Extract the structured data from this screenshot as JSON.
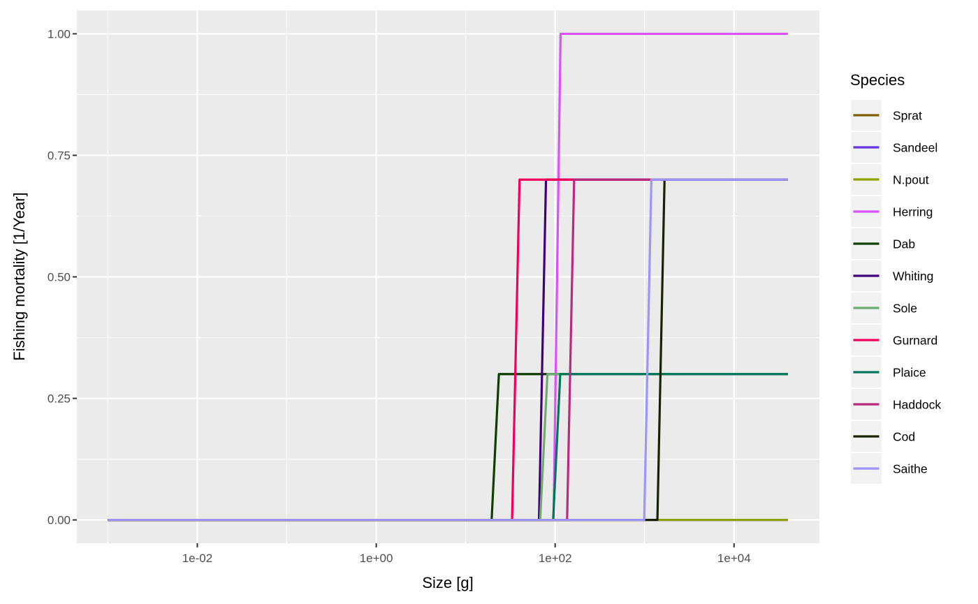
{
  "chart_data": {
    "type": "line",
    "title": "",
    "xlabel": "Size [g]",
    "ylabel": "Fishing mortality [1/Year]",
    "x_scale": "log10",
    "xlim": [
      0.00045,
      90000
    ],
    "ylim": [
      -0.048,
      1.048
    ],
    "x_ticks": [
      {
        "value": 0.01,
        "label": "1e-02"
      },
      {
        "value": 1,
        "label": "1e+00"
      },
      {
        "value": 100,
        "label": "1e+02"
      },
      {
        "value": 10000,
        "label": "1e+04"
      }
    ],
    "y_ticks": [
      {
        "value": 0,
        "label": "0.00"
      },
      {
        "value": 0.25,
        "label": "0.25"
      },
      {
        "value": 0.5,
        "label": "0.50"
      },
      {
        "value": 0.75,
        "label": "0.75"
      },
      {
        "value": 1,
        "label": "1.00"
      }
    ],
    "grid": true,
    "legend": {
      "title": "Species",
      "position": "right"
    },
    "series": [
      {
        "name": "Sprat",
        "color": "#815f00",
        "points": [
          [
            0.001,
            0
          ],
          [
            40000,
            0
          ]
        ]
      },
      {
        "name": "Sandeel",
        "color": "#6237e2",
        "points": [
          [
            0.001,
            0
          ],
          [
            40000,
            0
          ]
        ]
      },
      {
        "name": "N.pout",
        "color": "#8fa300",
        "points": [
          [
            0.001,
            0
          ],
          [
            40000,
            0
          ]
        ]
      },
      {
        "name": "Herring",
        "color": "#da51fe",
        "points": [
          [
            0.001,
            0
          ],
          [
            96,
            0
          ],
          [
            115,
            1.0
          ],
          [
            40000,
            1.0
          ]
        ]
      },
      {
        "name": "Dab",
        "color": "#0f3f00",
        "points": [
          [
            0.001,
            0
          ],
          [
            19.5,
            0
          ],
          [
            23.5,
            0.3
          ],
          [
            40000,
            0.3
          ]
        ]
      },
      {
        "name": "Whiting",
        "color": "#41007b",
        "points": [
          [
            0.001,
            0
          ],
          [
            66,
            0
          ],
          [
            79,
            0.7
          ],
          [
            40000,
            0.7
          ]
        ]
      },
      {
        "name": "Sole",
        "color": "#6fab71",
        "points": [
          [
            0.001,
            0
          ],
          [
            68,
            0
          ],
          [
            82,
            0.3
          ],
          [
            40000,
            0.3
          ]
        ]
      },
      {
        "name": "Gurnard",
        "color": "#f1005b",
        "points": [
          [
            0.001,
            0
          ],
          [
            33,
            0
          ],
          [
            40,
            0.7
          ],
          [
            40000,
            0.7
          ]
        ]
      },
      {
        "name": "Plaice",
        "color": "#007758",
        "points": [
          [
            0.001,
            0
          ],
          [
            95,
            0
          ],
          [
            114,
            0.3
          ],
          [
            40000,
            0.3
          ]
        ]
      },
      {
        "name": "Haddock",
        "color": "#b92b7f",
        "points": [
          [
            0.001,
            0
          ],
          [
            136,
            0
          ],
          [
            163,
            0.7
          ],
          [
            40000,
            0.7
          ]
        ]
      },
      {
        "name": "Cod",
        "color": "#182200",
        "points": [
          [
            0.001,
            0
          ],
          [
            1390,
            0
          ],
          [
            1670,
            0.7
          ],
          [
            40000,
            0.7
          ]
        ]
      },
      {
        "name": "Saithe",
        "color": "#9f93fd",
        "points": [
          [
            0.001,
            0
          ],
          [
            990,
            0
          ],
          [
            1190,
            0.7
          ],
          [
            40000,
            0.7
          ]
        ]
      }
    ],
    "draw_order": [
      "Sprat",
      "Sandeel",
      "N.pout",
      "Herring",
      "Dab",
      "Whiting",
      "Sole",
      "Gurnard",
      "Plaice",
      "Haddock",
      "Cod",
      "Saithe"
    ]
  }
}
